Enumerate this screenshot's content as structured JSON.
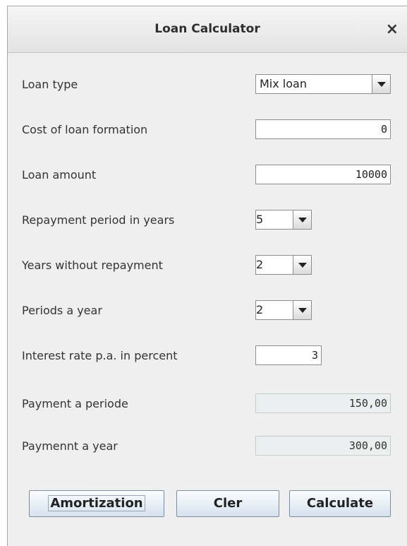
{
  "window": {
    "title": "Loan Calculator",
    "close_glyph": "×"
  },
  "form": {
    "loan_type": {
      "label": "Loan type",
      "value": "Mix loan"
    },
    "cost_of_loan_formation": {
      "label": "Cost of loan formation",
      "value": "0"
    },
    "loan_amount": {
      "label": "Loan amount",
      "value": "10000"
    },
    "repayment_period": {
      "label": "Repayment period in years",
      "value": "5"
    },
    "years_without_repayment": {
      "label": "Years without repayment",
      "value": "2"
    },
    "periods_a_year": {
      "label": "Periods a year",
      "value": "2"
    },
    "interest_rate": {
      "label": "Interest rate p.a. in percent",
      "value": "3"
    },
    "payment_a_periode": {
      "label": "Payment a periode",
      "value": "150,00"
    },
    "payment_a_year": {
      "label": "Paymennt a year",
      "value": "300,00"
    }
  },
  "buttons": {
    "amortization": "Amortization",
    "clear": "Cler",
    "calculate": "Calculate"
  },
  "icons": {
    "close": "close-icon",
    "dropdown": "chevron-down-icon"
  }
}
